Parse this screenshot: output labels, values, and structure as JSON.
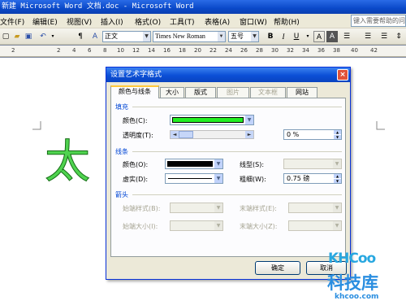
{
  "window": {
    "title": "新建 Microsoft Word 文档.doc - Microsoft Word"
  },
  "menu": {
    "items": [
      "文件(F)",
      "编辑(E)",
      "视图(V)",
      "插入(I)",
      "格式(O)",
      "工具(T)",
      "表格(A)",
      "窗口(W)",
      "帮助(H)"
    ],
    "help_placeholder": "键入需要帮助的问题"
  },
  "toolbar": {
    "style": "正文",
    "font": "Times New Roman",
    "size": "五号",
    "bold": "B",
    "italic": "I",
    "underline": "U",
    "font_color": "A"
  },
  "ruler": {
    "numbers": [
      "2",
      "2",
      "4",
      "6",
      "8",
      "10",
      "12",
      "14",
      "16",
      "18",
      "20",
      "22",
      "24",
      "26",
      "28",
      "30",
      "32",
      "34",
      "36",
      "38",
      "40",
      "42"
    ]
  },
  "document": {
    "wordart_text": "太"
  },
  "dialog": {
    "title": "设置艺术字格式",
    "close": "×",
    "tabs": [
      "颜色与线条",
      "大小",
      "版式",
      "图片",
      "文本框",
      "网站"
    ],
    "fill": {
      "section": "填充",
      "color_label": "颜色(C):",
      "color_value": "#22ee22",
      "transparency_label": "透明度(T):",
      "transparency_value": "0 %"
    },
    "line": {
      "section": "线条",
      "color_label": "颜色(O):",
      "color_value": "#000000",
      "style_label": "线型(S):",
      "dash_label": "虚实(D):",
      "weight_label": "粗细(W):",
      "weight_value": "0.75 磅"
    },
    "arrows": {
      "section": "箭头",
      "begin_style_label": "始端样式(B):",
      "end_style_label": "末端样式(E):",
      "begin_size_label": "始端大小(I):",
      "end_size_label": "末端大小(Z):"
    },
    "ok": "确定",
    "cancel": "取消"
  },
  "watermark": {
    "logo": "KHCoo",
    "name": "科技库",
    "url": "khcoo.com"
  }
}
